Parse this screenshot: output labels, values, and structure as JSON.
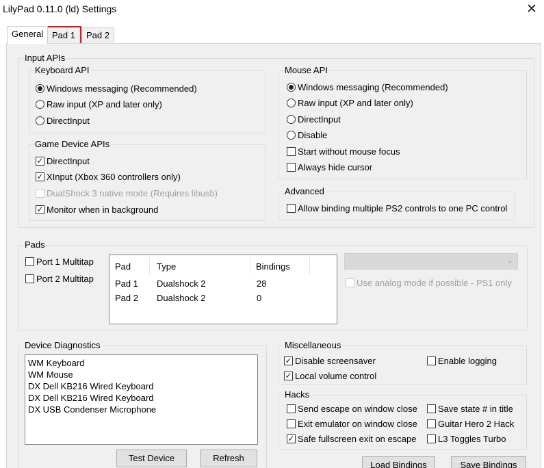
{
  "window": {
    "title": "LilyPad 0.11.0 (ld) Settings",
    "close_glyph": "✕"
  },
  "tabs": [
    {
      "label": "General",
      "active": true
    },
    {
      "label": "Pad 1",
      "active": false,
      "highlighted": true
    },
    {
      "label": "Pad 2",
      "active": false
    }
  ],
  "input_apis": {
    "label": "Input APIs",
    "keyboard_api": {
      "label": "Keyboard API",
      "options": [
        {
          "label": "Windows messaging (Recommended)",
          "selected": true
        },
        {
          "label": "Raw input (XP and later only)",
          "selected": false
        },
        {
          "label": "DirectInput",
          "selected": false
        }
      ]
    },
    "game_device_apis": {
      "label": "Game Device APIs",
      "options": [
        {
          "label": "DirectInput",
          "checked": true,
          "enabled": true
        },
        {
          "label": "XInput (Xbox 360 controllers only)",
          "checked": true,
          "enabled": true
        },
        {
          "label": "DualShock 3 native mode (Requires libusb)",
          "checked": false,
          "enabled": false
        },
        {
          "label": "Monitor when in background",
          "checked": true,
          "enabled": true
        }
      ]
    },
    "mouse_api": {
      "label": "Mouse API",
      "options": [
        {
          "label": "Windows messaging (Recommended)",
          "selected": true
        },
        {
          "label": "Raw input (XP and later only)",
          "selected": false
        },
        {
          "label": "DirectInput",
          "selected": false
        },
        {
          "label": "Disable",
          "selected": false
        }
      ],
      "checks": [
        {
          "label": "Start without mouse focus",
          "checked": false
        },
        {
          "label": "Always hide cursor",
          "checked": false
        }
      ]
    },
    "advanced": {
      "label": "Advanced",
      "option": {
        "label": "Allow binding multiple PS2 controls to one PC control",
        "checked": false
      }
    }
  },
  "pads": {
    "label": "Pads",
    "multitap": [
      {
        "label": "Port 1 Multitap",
        "checked": false
      },
      {
        "label": "Port 2 Multitap",
        "checked": false
      }
    ],
    "columns": [
      "Pad",
      "Type",
      "Bindings"
    ],
    "rows": [
      [
        "Pad 1",
        "Dualshock 2",
        "28"
      ],
      [
        "Pad 2",
        "Dualshock 2",
        "0"
      ]
    ],
    "dropdown_value": "",
    "analog_mode": {
      "label": "Use analog mode if possible - PS1 only",
      "checked": false,
      "enabled": false
    }
  },
  "device_diagnostics": {
    "label": "Device Diagnostics",
    "items": [
      "WM Keyboard",
      "WM Mouse",
      "DX Dell KB216 Wired Keyboard",
      "DX Dell KB216 Wired Keyboard",
      "DX USB Condenser Microphone"
    ],
    "test_device_label": "Test Device",
    "refresh_label": "Refresh"
  },
  "miscellaneous": {
    "label": "Miscellaneous",
    "options": [
      {
        "label": "Disable screensaver",
        "checked": true
      },
      {
        "label": "Enable logging",
        "checked": false
      },
      {
        "label": "Local volume control",
        "checked": true
      }
    ]
  },
  "hacks": {
    "label": "Hacks",
    "options": [
      {
        "label": "Send escape on window close",
        "checked": false
      },
      {
        "label": "Save state # in title",
        "checked": false
      },
      {
        "label": "Exit emulator on window close",
        "checked": false
      },
      {
        "label": "Guitar Hero 2 Hack",
        "checked": false
      },
      {
        "label": "Safe fullscreen exit on escape",
        "checked": true
      },
      {
        "label": "L3 Toggles Turbo",
        "checked": false
      }
    ]
  },
  "bottom_buttons": {
    "load_label": "Load Bindings",
    "save_label": "Save Bindings"
  },
  "icons": {
    "dropdown_arrow": "chevron-down-icon",
    "close": "close-icon"
  }
}
